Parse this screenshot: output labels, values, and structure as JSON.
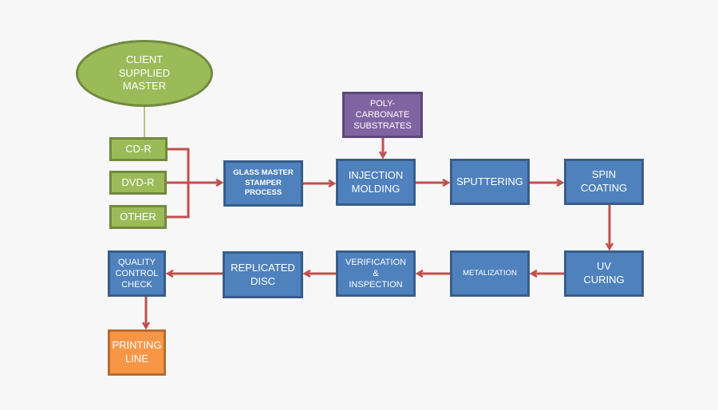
{
  "colors": {
    "process": "#4f81bd",
    "source": "#9bbb59",
    "input": "#8064a2",
    "output": "#f79646",
    "arrow": "#c0504d"
  },
  "nodes": {
    "client": "CLIENT\nSUPPLIED\nMASTER",
    "cdr": "CD-R",
    "dvdr": "DVD-R",
    "other": "OTHER",
    "glass": "GLASS MASTER\nSTAMPER\nPROCESS",
    "poly": "POLY-\nCARBONATE\nSUBSTRATES",
    "injection": "INJECTION\nMOLDING",
    "sputtering": "SPUTTERING",
    "spin": "SPIN\nCOATING",
    "uv": "UV\nCURING",
    "metalization": "METALIZATION",
    "verification": "VERIFICATION\n&\nINSPECTION",
    "replicated": "REPLICATED\nDISC",
    "quality": "QUALITY\nCONTROL\nCHECK",
    "printing": "PRINTING\nLINE"
  }
}
